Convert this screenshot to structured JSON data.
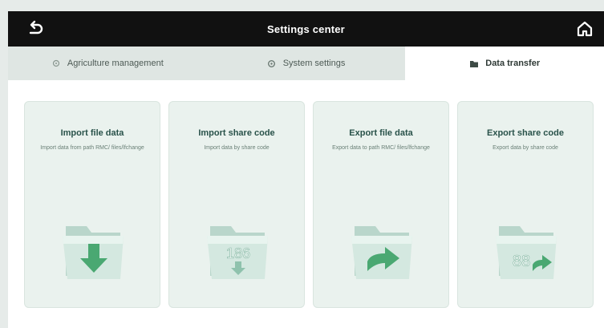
{
  "header": {
    "title": "Settings center",
    "back_icon": "back-arrow-icon",
    "home_icon": "home-icon"
  },
  "tabs": [
    {
      "label": "Agriculture management",
      "icon": "list-icon",
      "active": false
    },
    {
      "label": "System settings",
      "icon": "gear-icon",
      "active": false
    },
    {
      "label": "Data transfer",
      "icon": "folder-icon",
      "active": true
    }
  ],
  "cards": [
    {
      "title": "Import file data",
      "desc": "Import data from path RMC/ files/lfchange",
      "icon": "folder-import-icon"
    },
    {
      "title": "Import share code",
      "desc": "Import data by share code",
      "icon": "folder-code-import-icon",
      "code": "186"
    },
    {
      "title": "Export file data",
      "desc": "Export data to path RMC/ files/lfchange",
      "icon": "folder-export-icon"
    },
    {
      "title": "Export share code",
      "desc": "Export data by share code",
      "icon": "folder-code-export-icon",
      "code": "88"
    }
  ],
  "colors": {
    "topbar": "#111111",
    "tab_bg": "#dfe6e3",
    "card_bg": "#eaf2ee",
    "accent_green": "#3fae6a",
    "title_text": "#29524a"
  }
}
